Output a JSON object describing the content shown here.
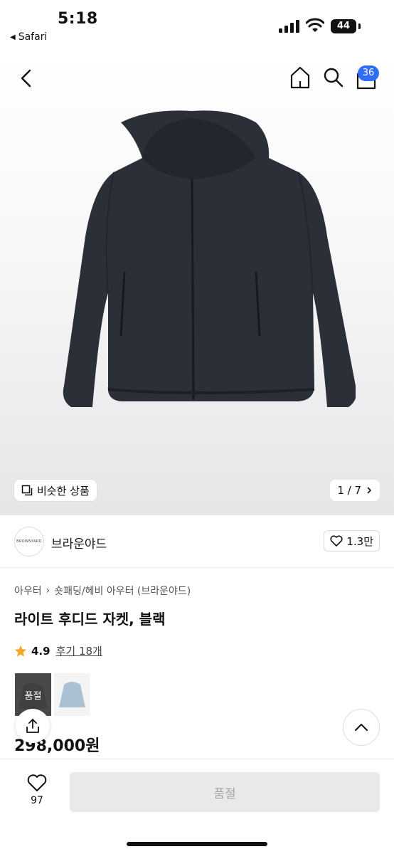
{
  "status_bar": {
    "time": "5:18",
    "back_app": "Safari",
    "battery": "44"
  },
  "header": {
    "cart_count": "36"
  },
  "hero": {
    "similar_label": "비슷한 상품",
    "pager": "1 / 7"
  },
  "brand": {
    "logo_text": "BROWNYARD",
    "name": "브라운야드",
    "likes": "1.3만"
  },
  "product": {
    "breadcrumb": [
      "아우터",
      "숏패딩/헤비 아우터 (브라운야드)"
    ],
    "title": "라이트 후디드 자켓, 블랙",
    "rating": "4.9",
    "reviews": "후기 18개",
    "swatch_sold_label": "품절",
    "price": "298,000원"
  },
  "bottom": {
    "wish_count": "97",
    "buy_label": "품절"
  },
  "colors": {
    "accent": "#2f6ef0",
    "star": "#f5a623",
    "disabled_bg": "#e9e9ea",
    "disabled_text": "#a5a5a8"
  }
}
